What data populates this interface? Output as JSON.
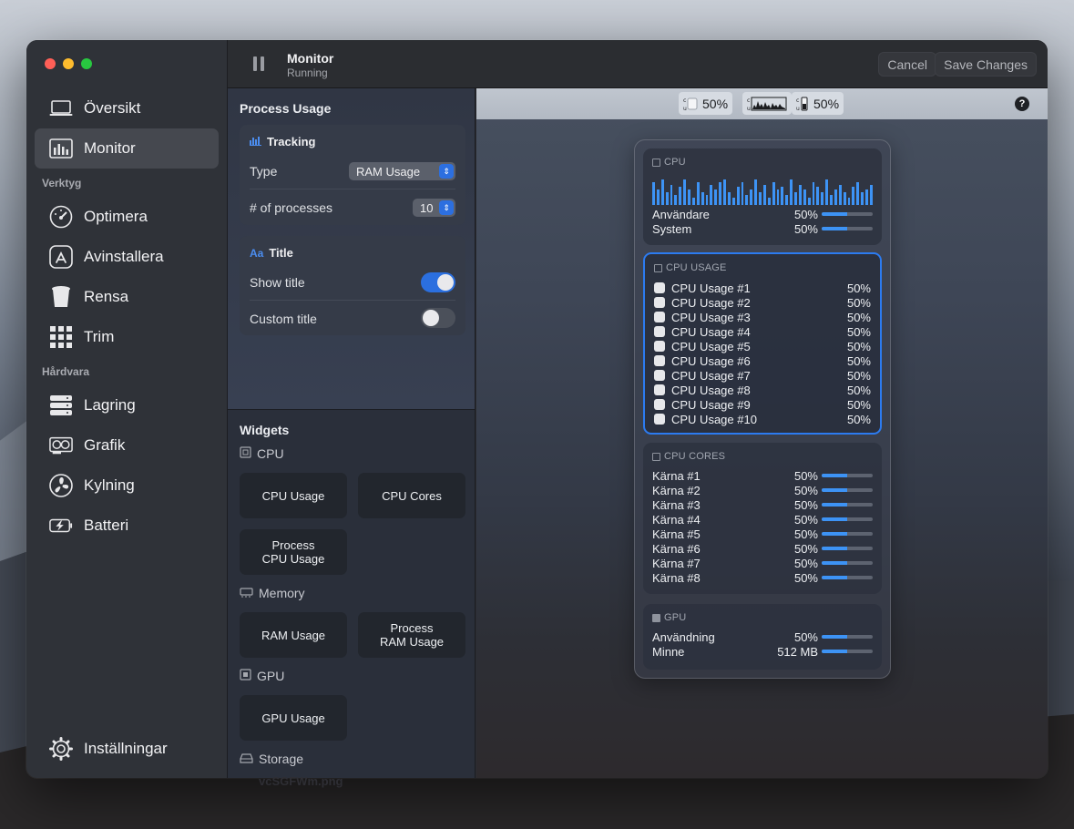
{
  "sidebar": {
    "items_top": [
      {
        "label": "Översikt",
        "icon": "laptop-icon"
      },
      {
        "label": "Monitor",
        "icon": "bar-chart-icon",
        "active": true
      }
    ],
    "section_tools": "Verktyg",
    "items_tools": [
      {
        "label": "Optimera",
        "icon": "gauge-icon"
      },
      {
        "label": "Avinstallera",
        "icon": "app-store-icon"
      },
      {
        "label": "Rensa",
        "icon": "trash-icon"
      },
      {
        "label": "Trim",
        "icon": "grid-icon"
      }
    ],
    "section_hardware": "Hårdvara",
    "items_hardware": [
      {
        "label": "Lagring",
        "icon": "drive-icon"
      },
      {
        "label": "Grafik",
        "icon": "gpu-card-icon"
      },
      {
        "label": "Kylning",
        "icon": "fan-icon"
      },
      {
        "label": "Batteri",
        "icon": "battery-charging-icon"
      }
    ],
    "settings": "Inställningar"
  },
  "toolbar": {
    "title": "Monitor",
    "subtitle": "Running",
    "cancel": "Cancel",
    "save": "Save Changes"
  },
  "config": {
    "heading": "Process Usage",
    "tracking": {
      "title": "Tracking",
      "type_label": "Type",
      "type_value": "RAM Usage",
      "processes_label": "# of processes",
      "processes_value": "10"
    },
    "title_card": {
      "title": "Title",
      "show_title_label": "Show title",
      "show_title_on": true,
      "custom_title_label": "Custom title",
      "custom_title_on": false
    },
    "widgets": {
      "heading": "Widgets",
      "cpu_group": "CPU",
      "cpu_usage": "CPU Usage",
      "cpu_cores": "CPU Cores",
      "process_cpu_1": "Process",
      "process_cpu_2": "CPU Usage",
      "memory_group": "Memory",
      "ram_usage": "RAM Usage",
      "process_ram_1": "Process",
      "process_ram_2": "RAM Usage",
      "gpu_group": "GPU",
      "gpu_usage": "GPU Usage",
      "storage_group": "Storage"
    }
  },
  "menubar": {
    "item1": "50%",
    "item3": "50%",
    "help": "?"
  },
  "preview": {
    "cpu": {
      "title": "CPU",
      "rows": [
        {
          "label": "Användare",
          "value": "50%",
          "pct": 0.5
        },
        {
          "label": "System",
          "value": "50%",
          "pct": 0.5
        }
      ]
    },
    "cpu_usage": {
      "title": "CPU USAGE",
      "rows": [
        {
          "label": "CPU Usage #1",
          "value": "50%"
        },
        {
          "label": "CPU Usage #2",
          "value": "50%"
        },
        {
          "label": "CPU Usage #3",
          "value": "50%"
        },
        {
          "label": "CPU Usage #4",
          "value": "50%"
        },
        {
          "label": "CPU Usage #5",
          "value": "50%"
        },
        {
          "label": "CPU Usage #6",
          "value": "50%"
        },
        {
          "label": "CPU Usage #7",
          "value": "50%"
        },
        {
          "label": "CPU Usage #8",
          "value": "50%"
        },
        {
          "label": "CPU Usage #9",
          "value": "50%"
        },
        {
          "label": "CPU Usage #10",
          "value": "50%"
        }
      ]
    },
    "cpu_cores": {
      "title": "CPU CORES",
      "rows": [
        {
          "label": "Kärna #1",
          "value": "50%",
          "pct": 0.5
        },
        {
          "label": "Kärna #2",
          "value": "50%",
          "pct": 0.5
        },
        {
          "label": "Kärna #3",
          "value": "50%",
          "pct": 0.5
        },
        {
          "label": "Kärna #4",
          "value": "50%",
          "pct": 0.5
        },
        {
          "label": "Kärna #5",
          "value": "50%",
          "pct": 0.5
        },
        {
          "label": "Kärna #6",
          "value": "50%",
          "pct": 0.5
        },
        {
          "label": "Kärna #7",
          "value": "50%",
          "pct": 0.5
        },
        {
          "label": "Kärna #8",
          "value": "50%",
          "pct": 0.5
        }
      ]
    },
    "gpu": {
      "title": "GPU",
      "rows": [
        {
          "label": "Användning",
          "value": "50%",
          "pct": 0.5
        },
        {
          "label": "Minne",
          "value": "512 MB",
          "pct": 0.5
        }
      ]
    }
  },
  "caption": "vcSGFWm.png",
  "colors": {
    "accent": "#2b6fdf",
    "bar": "#3d93f5",
    "selected_border": "#2c7bf0"
  }
}
